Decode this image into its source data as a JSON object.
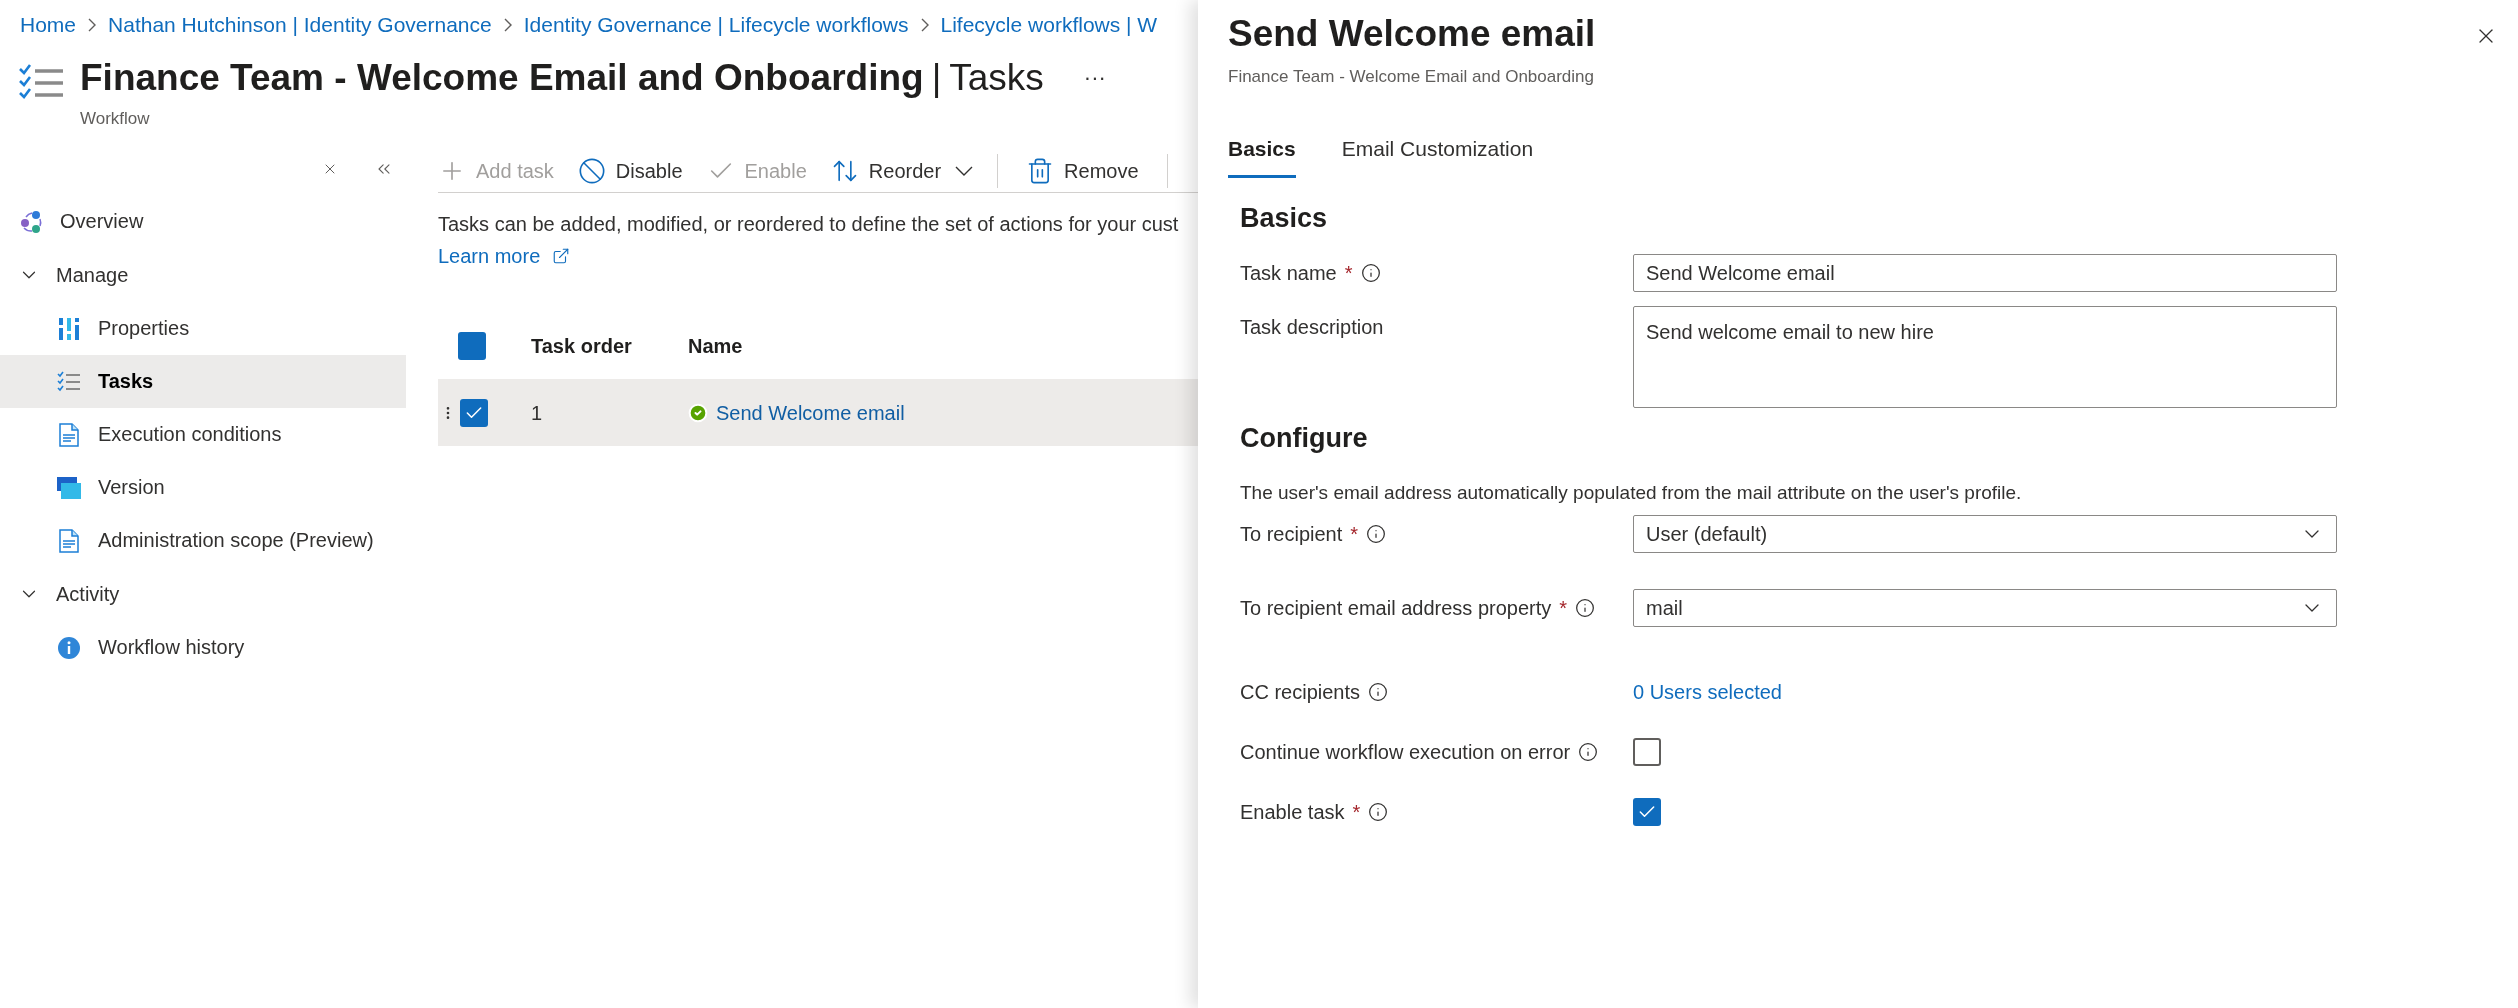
{
  "breadcrumb": [
    "Home",
    "Nathan Hutchinson | Identity Governance",
    "Identity Governance | Lifecycle workflows",
    "Lifecycle workflows | W"
  ],
  "page": {
    "title": "Finance Team - Welcome Email and Onboarding",
    "separator": "|",
    "section": "Tasks",
    "subtitle": "Workflow",
    "more": "···"
  },
  "sidebar": [
    {
      "kind": "item",
      "label": "Overview",
      "selected": false
    },
    {
      "kind": "group",
      "label": "Manage",
      "expanded": true,
      "children": [
        {
          "label": "Properties",
          "selected": false
        },
        {
          "label": "Tasks",
          "selected": true
        },
        {
          "label": "Execution conditions",
          "selected": false
        },
        {
          "label": "Version",
          "selected": false
        },
        {
          "label": "Administration scope (Preview)",
          "selected": false
        }
      ]
    },
    {
      "kind": "group",
      "label": "Activity",
      "expanded": true,
      "children": [
        {
          "label": "Workflow history",
          "selected": false
        }
      ]
    }
  ],
  "toolbar": [
    {
      "label": "Add task",
      "disabled": true,
      "menu": false
    },
    {
      "label": "Disable",
      "disabled": false,
      "menu": false
    },
    {
      "label": "Enable",
      "disabled": true,
      "menu": false
    },
    {
      "label": "Reorder",
      "disabled": false,
      "menu": true
    },
    {
      "label": "Remove",
      "disabled": false,
      "menu": false
    }
  ],
  "description": "Tasks can be added, modified, or reordered to define the set of actions for your cust",
  "learn_more": "Learn more",
  "table": {
    "all_checked": true,
    "columns": [
      "Task order",
      "Name"
    ],
    "rows": [
      {
        "order": "1",
        "name": "Send Welcome email",
        "checked": true,
        "selected": true
      }
    ]
  },
  "panel": {
    "title": "Send Welcome email",
    "subtitle": "Finance Team - Welcome Email and Onboarding",
    "tabs": [
      {
        "label": "Basics",
        "selected": true
      },
      {
        "label": "Email Customization",
        "selected": false
      }
    ],
    "sections": [
      {
        "heading": "Basics",
        "fields": [
          {
            "kind": "text",
            "label": "Task name",
            "required_mark": "*",
            "info": true,
            "value": "Send Welcome email"
          },
          {
            "kind": "textarea",
            "label": "Task description",
            "info": false,
            "value": "Send welcome email to new hire"
          }
        ]
      },
      {
        "heading": "Configure",
        "note": "The user's email address automatically populated from the mail attribute on the user's profile.",
        "fields": [
          {
            "kind": "dropdown",
            "label": "To recipient",
            "required_mark": "*",
            "info": true,
            "value": "User (default)"
          },
          {
            "kind": "dropdown",
            "label": "To recipient email address property",
            "required_mark": "*",
            "info": true,
            "value": "mail"
          },
          {
            "kind": "link",
            "label": "CC recipients",
            "info": true,
            "value": "0 Users selected"
          },
          {
            "kind": "checkbox",
            "label": "Continue workflow execution on error",
            "info": true,
            "checked": false
          },
          {
            "kind": "checkbox",
            "label": "Enable task",
            "required_mark": "*",
            "info": true,
            "checked": true
          }
        ]
      }
    ]
  }
}
